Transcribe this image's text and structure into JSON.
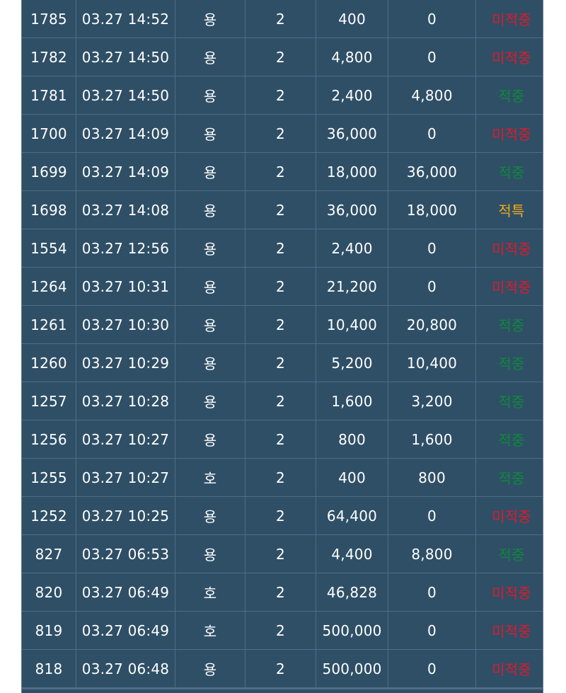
{
  "colors": {
    "background": "#2f4f66",
    "grid": "#4c6e86",
    "text": "#ffffff",
    "miss": "#e0192c",
    "hit": "#0d8a3a",
    "special": "#f1a91a"
  },
  "rows": [
    {
      "no": "1785",
      "time": "03.27 14:52",
      "pick": "용",
      "odds": "2",
      "bet": "400",
      "win": "0",
      "result": "미적중",
      "status": "miss"
    },
    {
      "no": "1782",
      "time": "03.27 14:50",
      "pick": "용",
      "odds": "2",
      "bet": "4,800",
      "win": "0",
      "result": "미적중",
      "status": "miss"
    },
    {
      "no": "1781",
      "time": "03.27 14:50",
      "pick": "용",
      "odds": "2",
      "bet": "2,400",
      "win": "4,800",
      "result": "적중",
      "status": "hit"
    },
    {
      "no": "1700",
      "time": "03.27 14:09",
      "pick": "용",
      "odds": "2",
      "bet": "36,000",
      "win": "0",
      "result": "미적중",
      "status": "miss"
    },
    {
      "no": "1699",
      "time": "03.27 14:09",
      "pick": "용",
      "odds": "2",
      "bet": "18,000",
      "win": "36,000",
      "result": "적중",
      "status": "hit"
    },
    {
      "no": "1698",
      "time": "03.27 14:08",
      "pick": "용",
      "odds": "2",
      "bet": "36,000",
      "win": "18,000",
      "result": "적특",
      "status": "special"
    },
    {
      "no": "1554",
      "time": "03.27 12:56",
      "pick": "용",
      "odds": "2",
      "bet": "2,400",
      "win": "0",
      "result": "미적중",
      "status": "miss"
    },
    {
      "no": "1264",
      "time": "03.27 10:31",
      "pick": "용",
      "odds": "2",
      "bet": "21,200",
      "win": "0",
      "result": "미적중",
      "status": "miss"
    },
    {
      "no": "1261",
      "time": "03.27 10:30",
      "pick": "용",
      "odds": "2",
      "bet": "10,400",
      "win": "20,800",
      "result": "적중",
      "status": "hit"
    },
    {
      "no": "1260",
      "time": "03.27 10:29",
      "pick": "용",
      "odds": "2",
      "bet": "5,200",
      "win": "10,400",
      "result": "적중",
      "status": "hit"
    },
    {
      "no": "1257",
      "time": "03.27 10:28",
      "pick": "용",
      "odds": "2",
      "bet": "1,600",
      "win": "3,200",
      "result": "적중",
      "status": "hit"
    },
    {
      "no": "1256",
      "time": "03.27 10:27",
      "pick": "용",
      "odds": "2",
      "bet": "800",
      "win": "1,600",
      "result": "적중",
      "status": "hit"
    },
    {
      "no": "1255",
      "time": "03.27 10:27",
      "pick": "호",
      "odds": "2",
      "bet": "400",
      "win": "800",
      "result": "적중",
      "status": "hit"
    },
    {
      "no": "1252",
      "time": "03.27 10:25",
      "pick": "용",
      "odds": "2",
      "bet": "64,400",
      "win": "0",
      "result": "미적중",
      "status": "miss"
    },
    {
      "no": "827",
      "time": "03.27 06:53",
      "pick": "용",
      "odds": "2",
      "bet": "4,400",
      "win": "8,800",
      "result": "적중",
      "status": "hit"
    },
    {
      "no": "820",
      "time": "03.27 06:49",
      "pick": "호",
      "odds": "2",
      "bet": "46,828",
      "win": "0",
      "result": "미적중",
      "status": "miss"
    },
    {
      "no": "819",
      "time": "03.27 06:49",
      "pick": "호",
      "odds": "2",
      "bet": "500,000",
      "win": "0",
      "result": "미적중",
      "status": "miss"
    },
    {
      "no": "818",
      "time": "03.27 06:48",
      "pick": "용",
      "odds": "2",
      "bet": "500,000",
      "win": "0",
      "result": "미적중",
      "status": "miss"
    }
  ]
}
